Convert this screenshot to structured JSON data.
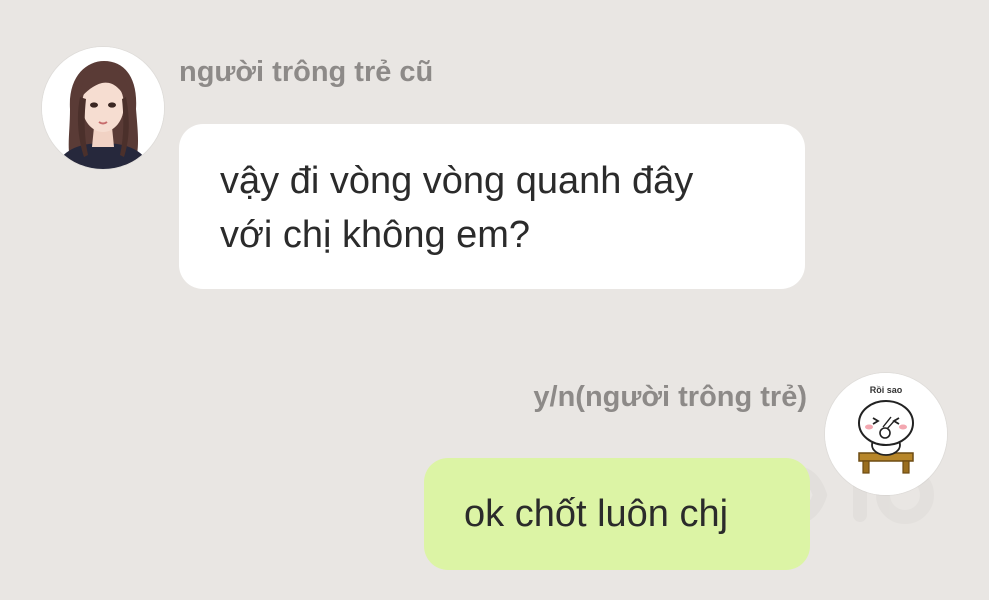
{
  "colors": {
    "background": "#e9e6e3",
    "incoming_bubble": "#ffffff",
    "outgoing_bubble": "#dcf4a5",
    "sender_name": "#8d8a88",
    "message_text": "#2b2b2b"
  },
  "incoming": {
    "sender": "người trông trẻ cũ",
    "avatar_icon": "anime-girl-avatar-icon",
    "message": "vậy đi vòng vòng quanh đây\nvới chị không em?"
  },
  "outgoing": {
    "sender": "y/n(người trông trẻ)",
    "avatar_icon": "sticker-avatar-icon",
    "avatar_caption": "Rồi sao",
    "message": "ok chốt luôn chj"
  }
}
